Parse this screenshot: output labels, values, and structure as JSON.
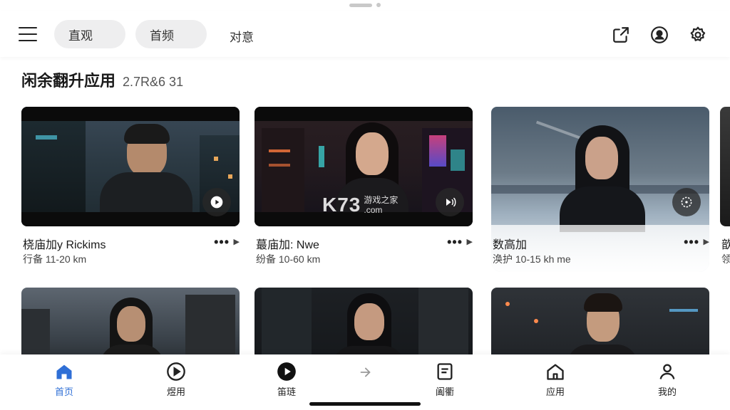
{
  "header": {
    "chips": [
      "直观",
      "首频"
    ],
    "tab": "对意"
  },
  "section": {
    "title": "闲余翻升应用",
    "subtitle": "2.7R&6  31"
  },
  "cards": [
    {
      "name": "桡庙加y Rickims",
      "sub": "行备 11-20 km",
      "more": "•••"
    },
    {
      "name": "蕞庙加: Nwe",
      "sub": "纷备 10-60 km",
      "more": "•••"
    },
    {
      "name": "数高加",
      "sub": "涣护 10-15 kh me",
      "more": "•••"
    },
    {
      "name": "歆",
      "sub": "领",
      "more": ""
    }
  ],
  "watermark": {
    "logo": "K73",
    "line1": "游戏之家",
    "line2": ".com"
  },
  "nav": [
    {
      "label": "首页",
      "icon": "home-icon",
      "active": true
    },
    {
      "label": "煜用",
      "icon": "play-circle-icon",
      "active": false
    },
    {
      "label": "笛琏",
      "icon": "play-filled-icon",
      "active": false
    },
    {
      "label": "阖衢",
      "icon": "document-icon",
      "active": false
    },
    {
      "label": "应用",
      "icon": "house-outline-icon",
      "active": false
    },
    {
      "label": "我的",
      "icon": "person-icon",
      "active": false
    }
  ],
  "colors": {
    "accent": "#2f6fd6",
    "chip_bg": "#eeeeef",
    "text": "#1a1a1a"
  }
}
